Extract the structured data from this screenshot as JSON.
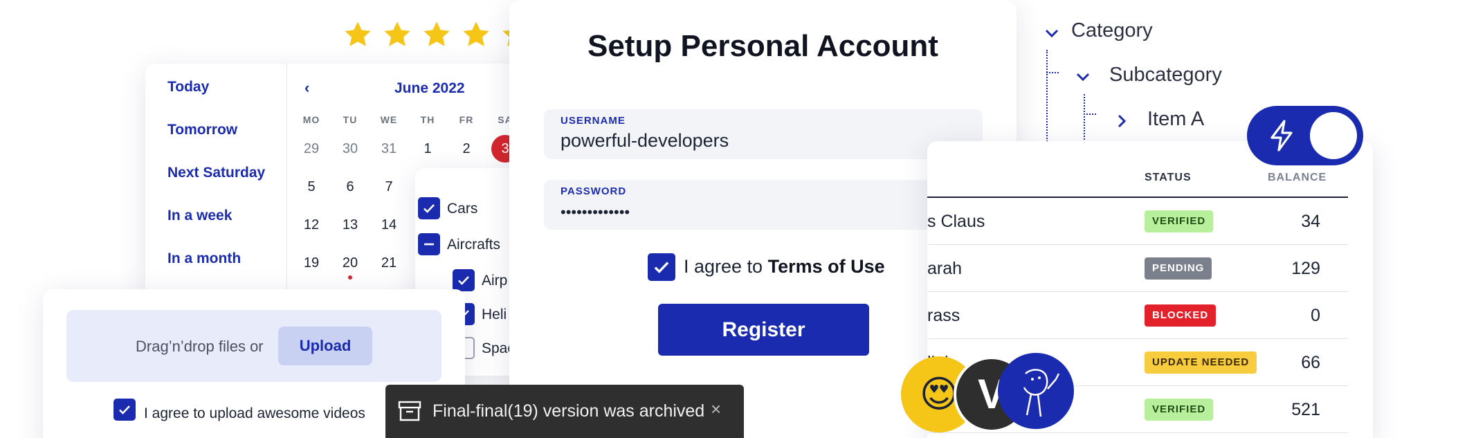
{
  "rating": {
    "value": 4.5,
    "max": 5,
    "star_color": "#f5c518"
  },
  "date_picker": {
    "presets": [
      "Today",
      "Tomorrow",
      "Next Saturday",
      "In a week",
      "In a month"
    ],
    "prev_icon": "chevron-left-icon",
    "month_label": "June 2022",
    "weekdays": [
      "MO",
      "TU",
      "WE",
      "TH",
      "FR",
      "SA"
    ],
    "weeks": [
      [
        "29",
        "30",
        "31",
        "1",
        "2",
        "3"
      ],
      [
        "5",
        "6",
        "7",
        "",
        "",
        ""
      ],
      [
        "12",
        "13",
        "14",
        "",
        "",
        ""
      ],
      [
        "19",
        "20",
        "21",
        "",
        "",
        ""
      ]
    ],
    "selected_day": "3",
    "marked_day": "20",
    "accent_color": "#1a2bb0",
    "selected_color": "#d6262d"
  },
  "checkbox_tree": {
    "items": [
      {
        "label": "Cars",
        "state": "checked"
      },
      {
        "label": "Aircrafts",
        "state": "indeterminate"
      },
      {
        "label": "Airp",
        "state": "checked"
      },
      {
        "label": "Heli",
        "state": "checked"
      },
      {
        "label": "Spac",
        "state": "unchecked"
      }
    ]
  },
  "upload": {
    "drop_text": "Drag’n’drop files or",
    "button_label": "Upload",
    "agree_label": "I agree to upload awesome videos",
    "agree_checked": true
  },
  "setup_form": {
    "title": "Setup Personal Account",
    "username_label": "USERNAME",
    "username_value": "powerful-developers",
    "password_label": "PASSWORD",
    "password_value": "•••••••••••••",
    "agree_prefix": "I agree to ",
    "agree_link": "Terms of Use",
    "agree_checked": true,
    "register_label": "Register"
  },
  "snackbar": {
    "icon": "archive-icon",
    "message": "Final-final(19) version was archived",
    "close_symbol": "×"
  },
  "category_tree": {
    "category": "Category",
    "subcategory": "Subcategory",
    "item": "Item A"
  },
  "toggle": {
    "on": true,
    "icon": "lightning-icon"
  },
  "users_table": {
    "headers": {
      "status": "STATUS",
      "balance": "BALANCE"
    },
    "rows": [
      {
        "name": "s Claus",
        "status": "VERIFIED",
        "balance": "34",
        "badge_bg": "#b8ef9d",
        "badge_fg": "#1f4d12"
      },
      {
        "name": "arah",
        "status": "PENDING",
        "balance": "129",
        "badge_bg": "#7a808c",
        "badge_fg": "#ffffff"
      },
      {
        "name": "rass",
        "status": "BLOCKED",
        "balance": "0",
        "badge_bg": "#e3212b",
        "badge_fg": "#ffffff"
      },
      {
        "name": "llah",
        "status": "UPDATE NEEDED",
        "balance": "66",
        "badge_bg": "#f7cc3f",
        "badge_fg": "#3b2a00"
      },
      {
        "name": "",
        "status": "VERIFIED",
        "balance": "521",
        "badge_bg": "#b8ef9d",
        "badge_fg": "#1f4d12"
      }
    ]
  },
  "avatars": [
    {
      "type": "emoji",
      "content": "😍",
      "bg": "#f5c518"
    },
    {
      "type": "initial",
      "content": "V",
      "bg": "#2e2e2e"
    },
    {
      "type": "illustration",
      "content": "doodle-face-icon",
      "bg": "#1a2bb0"
    }
  ]
}
